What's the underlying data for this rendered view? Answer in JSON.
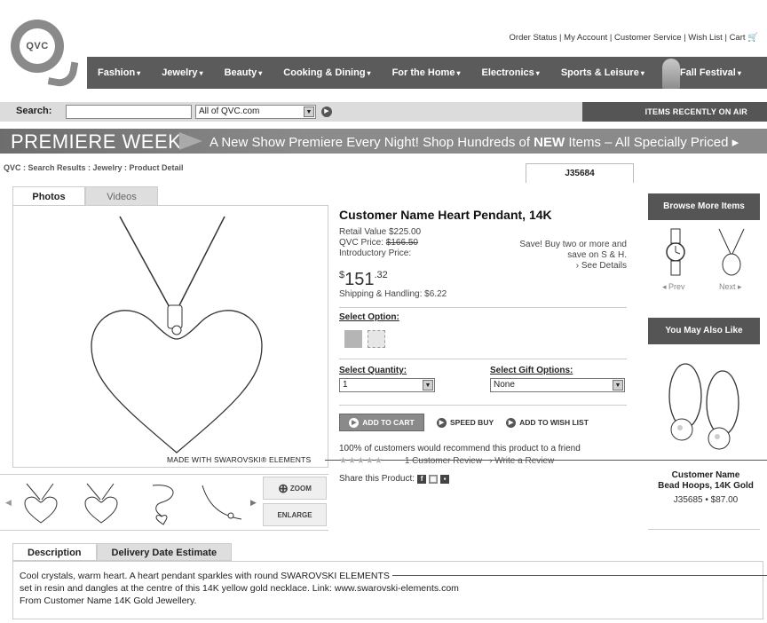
{
  "logo": {
    "text": "QVC"
  },
  "utility_links": [
    "Order Status",
    "My Account",
    "Customer Service",
    "Wish List",
    "Cart"
  ],
  "nav": {
    "items": [
      "Fashion",
      "Jewelry",
      "Beauty",
      "Cooking & Dining",
      "For the Home",
      "Electronics",
      "Sports & Leisure",
      "Fall Festival"
    ]
  },
  "search": {
    "label": "Search:",
    "value": "",
    "scope": "All of QVC.com",
    "recently_on_air": "ITEMS RECENTLY ON AIR"
  },
  "banner": {
    "title": "PREMIERE WEEK",
    "text_prefix": "A New Show Premiere Every Night! Shop Hundreds of ",
    "text_bold": "NEW",
    "text_suffix": " Items – All Specially Priced"
  },
  "breadcrumb": "QVC : Search Results : Jewelry : Product Detail",
  "sku": "J35684",
  "photo_tabs": [
    "Photos",
    "Videos"
  ],
  "photo_note": "MADE WITH SWAROVSKI® ELEMENTS",
  "thumbs": {
    "zoom": "ZOOM",
    "enlarge": "ENLARGE"
  },
  "product": {
    "title": "Customer Name Heart Pendant, 14K",
    "retail_value": "Retail Value $225.00",
    "qvc_price_label": "QVC Price: ",
    "qvc_price": "$166.50",
    "intro_label": "Introductory Price:",
    "price_dollars": "151",
    "price_cents": ".32",
    "price_currency": "$",
    "shipping": "Shipping & Handling: $6.22",
    "save_line1": "Save! Buy two or more and",
    "save_line2": "save on S & H.",
    "see_details": "› See Details",
    "select_option": "Select Option:",
    "select_quantity": "Select Quantity:",
    "quantity_value": "1",
    "select_gift": "Select Gift Options:",
    "gift_value": "None",
    "add_to_cart": "ADD TO CART",
    "speed_buy": "SPEED BUY",
    "add_to_wish": "ADD TO WISH LIST",
    "recommend": "100% of customers would recommend this product to a friend",
    "stars": "★★★★★",
    "review_count": "1 Customer Review",
    "write_review": "› Write a Review",
    "share": "Share this Product:"
  },
  "sidebar": {
    "browse_title": "Browse More Items",
    "prev": "◂ Prev",
    "next": "Next ▸",
    "also_like_title": "You May Also Like",
    "related_title_1": "Customer Name",
    "related_title_2": "Bead Hoops, 14K Gold",
    "related_sku_price": "J35685 • $87.00"
  },
  "description": {
    "tabs": [
      "Description",
      "Delivery Date Estimate"
    ],
    "line1": "Cool crystals, warm heart. A heart pendant sparkles with round SWAROVSKI ELEMENTS",
    "line2": "set in resin and dangles at the centre of this 14K yellow gold necklace. Link: www.swarovski-elements.com",
    "line3": "From Customer Name 14K Gold Jewellery."
  }
}
